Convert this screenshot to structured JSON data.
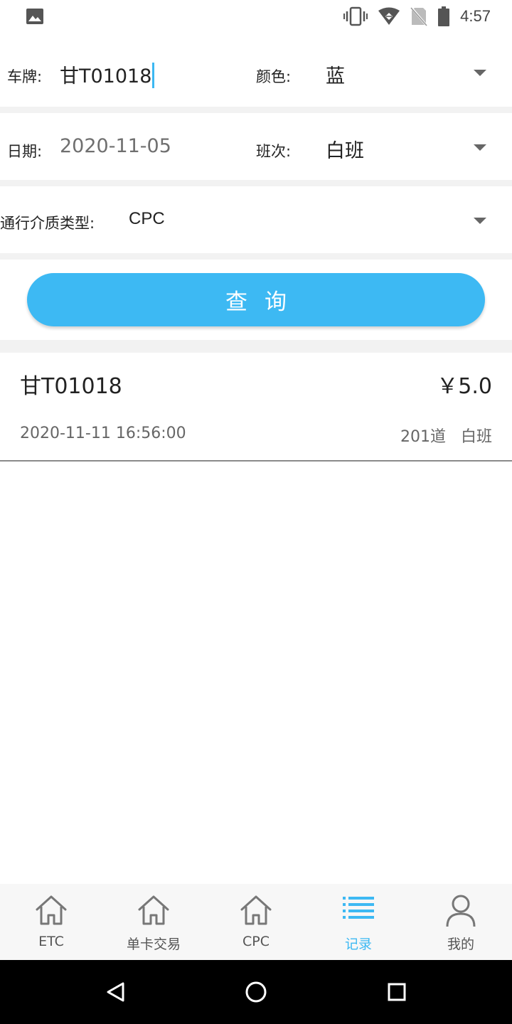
{
  "status_bar": {
    "time": "4:57",
    "icons": [
      "image-icon",
      "vibrate-icon",
      "wifi-icon",
      "no-sim-icon",
      "battery-icon"
    ]
  },
  "form": {
    "plate_label": "车牌:",
    "plate_value": "甘T01018",
    "color_label": "颜色:",
    "color_value": "蓝",
    "date_label": "日期:",
    "date_value": "2020-11-05",
    "shift_label": "班次:",
    "shift_value": "白班",
    "medium_label": "通行介质类型:",
    "medium_value": "CPC",
    "query_label": "查询"
  },
  "records": [
    {
      "plate": "甘T01018",
      "amount": "￥5.0",
      "time": "2020-11-11 16:56:00",
      "lane": "201道",
      "shift": "白班"
    }
  ],
  "tabs": [
    {
      "label": "ETC",
      "icon": "home-icon",
      "active": false
    },
    {
      "label": "单卡交易",
      "icon": "home-icon",
      "active": false
    },
    {
      "label": "CPC",
      "icon": "home-icon",
      "active": false
    },
    {
      "label": "记录",
      "icon": "list-icon",
      "active": true
    },
    {
      "label": "我的",
      "icon": "person-icon",
      "active": false
    }
  ],
  "colors": {
    "accent": "#3db9f3",
    "separator": "#f2f2f2",
    "tab_bar": "#f7f7f7"
  }
}
